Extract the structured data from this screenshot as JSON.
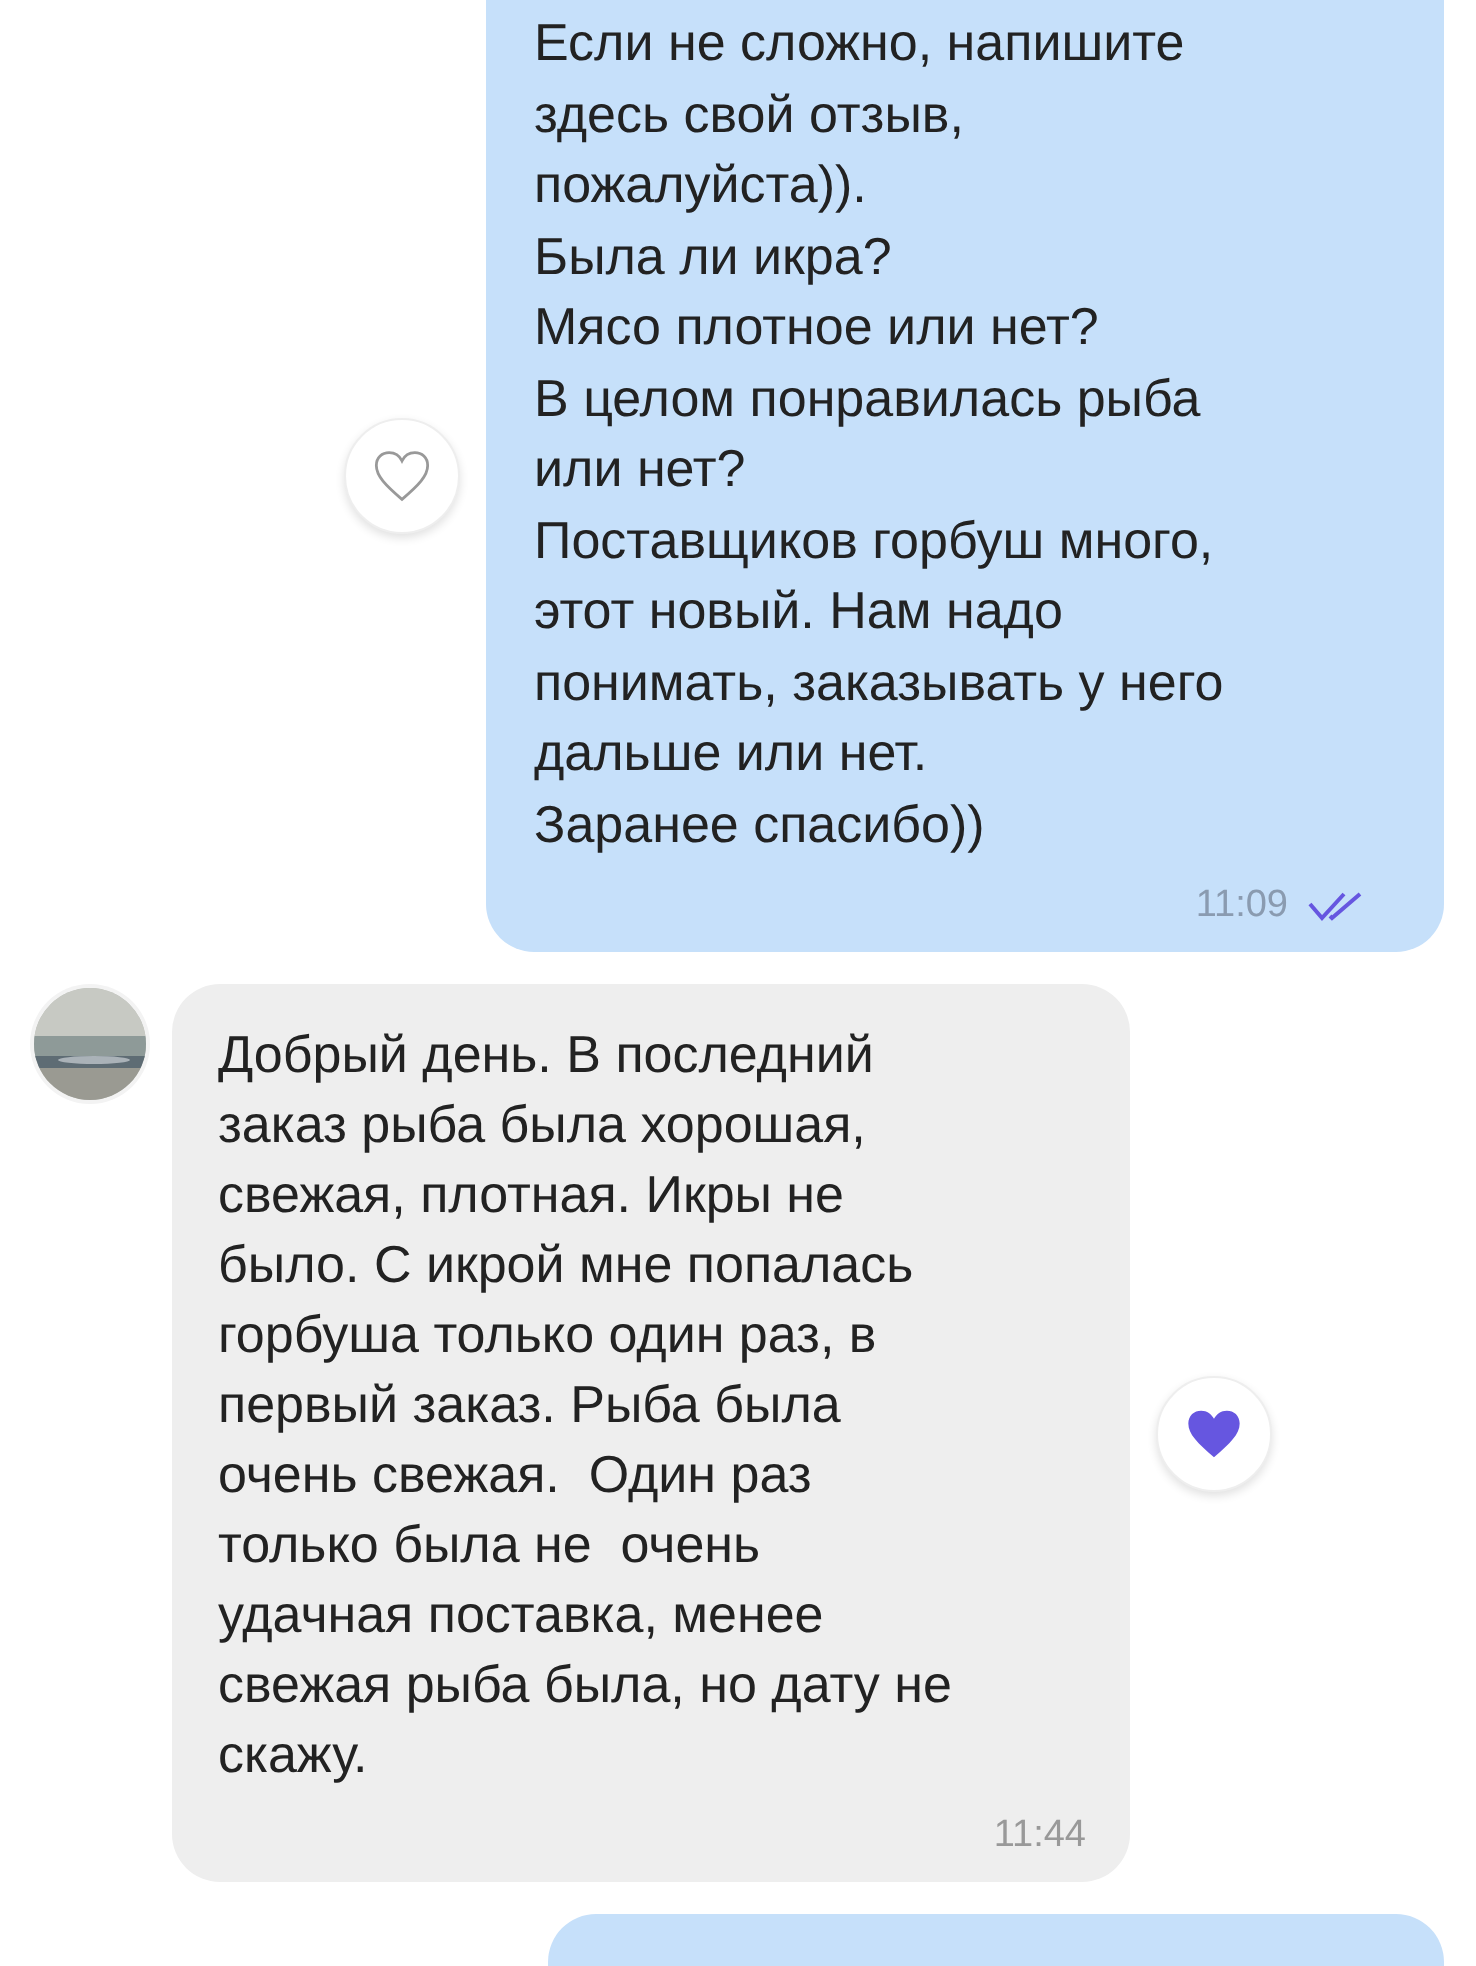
{
  "messages": [
    {
      "kind": "outgoing",
      "text": "Если не сложно, напишите\nздесь свой отзыв,\nпожалуйста)).\nБыла ли икра?\nМясо плотное или нет?\nВ целом понравилась рыба\nили нет?\nПоставщиков горбуш много,\nэтот новый. Нам надо\nпонимать, заказывать у него\nдальше или нет.\nЗаранее спасибо))",
      "time": "11:09",
      "read": true,
      "liked": false
    },
    {
      "kind": "incoming",
      "text": "Добрый день. В последний\nзаказ рыба была хорошая,\nсвежая, плотная. Икры не\nбыло. С икрой мне попалась\nгорбуша только один раз, в\nпервый заказ. Рыба была\nочень свежая.  Один раз\nтолько была не  очень\nудачная поставка, менее\nсвежая рыба была, но дату не\nскажу.",
      "time": "11:44",
      "liked": true
    },
    {
      "kind": "outgoing"
    }
  ]
}
